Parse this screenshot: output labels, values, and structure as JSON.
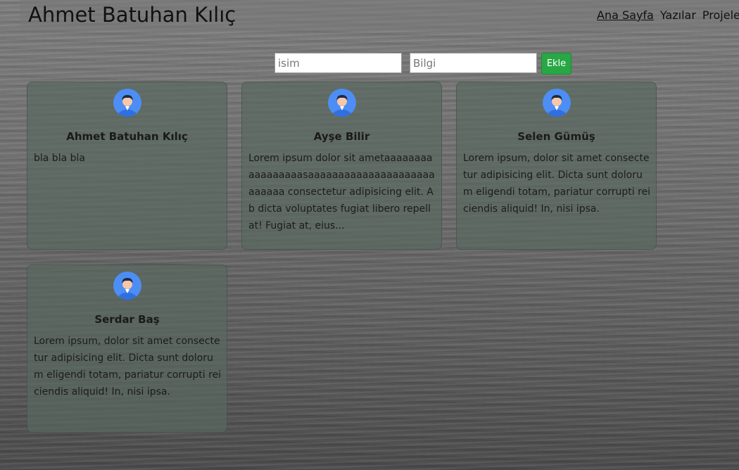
{
  "header": {
    "brand": "Ahmet Batuhan Kılıç",
    "nav": [
      {
        "label": "Ana Sayfa",
        "active": true
      },
      {
        "label": "Yazılar",
        "active": false
      },
      {
        "label": "Projeler",
        "active": false
      }
    ]
  },
  "form": {
    "name_placeholder": "isim",
    "info_placeholder": "Bilgi",
    "add_label": "Ekle"
  },
  "cards": [
    {
      "name": "Ahmet Batuhan Kılıç",
      "text": "bla bla bla",
      "avatar": "user-avatar-icon"
    },
    {
      "name": "Ayşe Bilir",
      "text": "Lorem ipsum dolor sit ametaaaaaaaaaaaaaaaaasaaaaaaaaaaaaaaaaaaaaaaaaaaa consectetur adipisicing elit. Ab dicta voluptates fugiat libero repellat! Fugiat at, eius...",
      "avatar": "user-avatar-icon"
    },
    {
      "name": "Selen Gümüş",
      "text": "Lorem ipsum, dolor sit amet consectetur adipisicing elit. Dicta sunt dolorum eligendi totam, pariatur corrupti reiciendis aliquid! In, nisi ipsa.",
      "avatar": "user-avatar-icon"
    },
    {
      "name": "Serdar Baş",
      "text": "Lorem ipsum, dolor sit amet consectetur adipisicing elit. Dicta sunt dolorum eligendi totam, pariatur corrupti reiciendis aliquid! In, nisi ipsa.",
      "avatar": "user-avatar-icon"
    }
  ],
  "colors": {
    "accent_button": "#28a745",
    "card_background": "#586860",
    "avatar_blue": "#4d8ef5"
  }
}
